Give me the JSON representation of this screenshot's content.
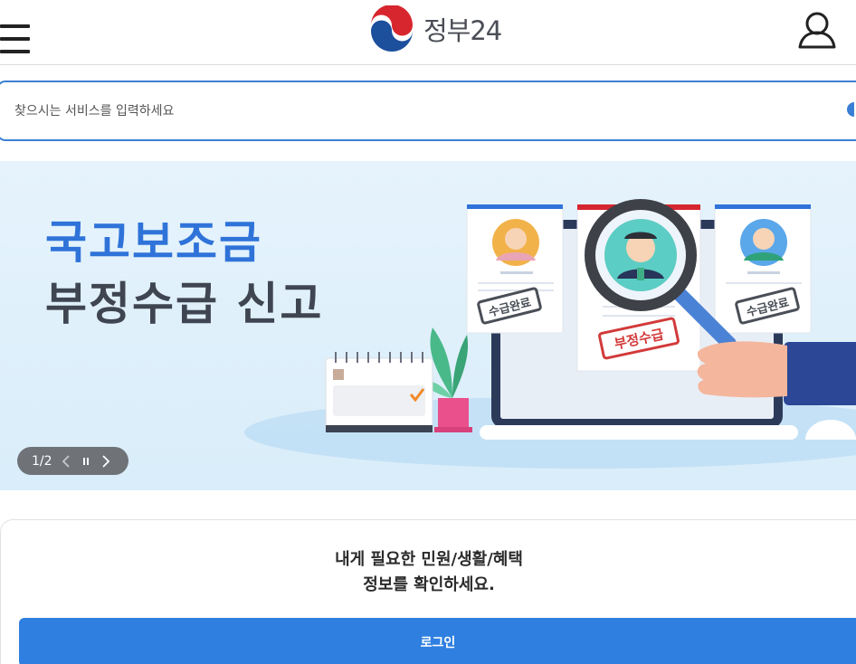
{
  "header": {
    "logo_text": "정부24"
  },
  "search": {
    "placeholder": "찾으시는 서비스를 입력하세요"
  },
  "banner": {
    "title_line1": "국고보조금",
    "title_line2": "부정수급 신고",
    "stamp_left": "수급완료",
    "stamp_center": "부정수급",
    "stamp_right": "수급완료",
    "slide_counter": "1/2"
  },
  "login_card": {
    "message_line1": "내게 필요한 민원/생활/혜택",
    "message_line2": "정보를 확인하세요.",
    "login_label": "로그인"
  },
  "colors": {
    "accent": "#2f7fe0",
    "title_blue": "#2f73d9",
    "title_dark": "#3f4651",
    "stamp_red": "#d23a3a"
  }
}
